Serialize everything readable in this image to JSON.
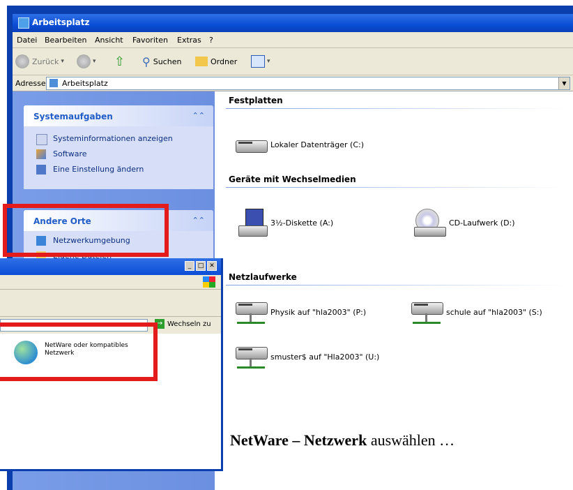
{
  "window": {
    "title": "Arbeitsplatz",
    "menu": [
      "Datei",
      "Bearbeiten",
      "Ansicht",
      "Favoriten",
      "Extras",
      "?"
    ],
    "toolbar": {
      "back": "Zurück",
      "search": "Suchen",
      "folders": "Ordner"
    },
    "address": {
      "label": "Adresse",
      "value": "Arbeitsplatz"
    }
  },
  "sidebar": {
    "system": {
      "title": "Systemaufgaben",
      "items": [
        "Systeminformationen anzeigen",
        "Software",
        "Eine Einstellung ändern"
      ]
    },
    "other": {
      "title": "Andere Orte",
      "items": [
        "Netzwerkumgebung",
        "Eigene Dateien"
      ]
    }
  },
  "content": {
    "groups": [
      {
        "title": "Festplatten",
        "items": [
          "Lokaler Datenträger (C:)"
        ]
      },
      {
        "title": "Geräte mit Wechselmedien",
        "items": [
          "3½-Diskette (A:)",
          "CD-Laufwerk (D:)"
        ]
      },
      {
        "title": "Netzlaufwerke",
        "items": [
          "Physik auf \"hla2003\" (P:)",
          "schule auf \"hla2003\" (S:)",
          "smuster$ auf \"Hla2003\" (U:)"
        ]
      }
    ]
  },
  "overlay": {
    "go_label": "Wechseln zu",
    "network_item": "NetWare oder kompatibles Netzwerk"
  },
  "caption": {
    "bold1": "NetWare –",
    "bold2": "Netzwerk",
    "rest": "auswählen …"
  },
  "colors": {
    "highlight": "#e41b1b",
    "xp_blue": "#0b3fae",
    "task_blue": "#215dc6"
  }
}
